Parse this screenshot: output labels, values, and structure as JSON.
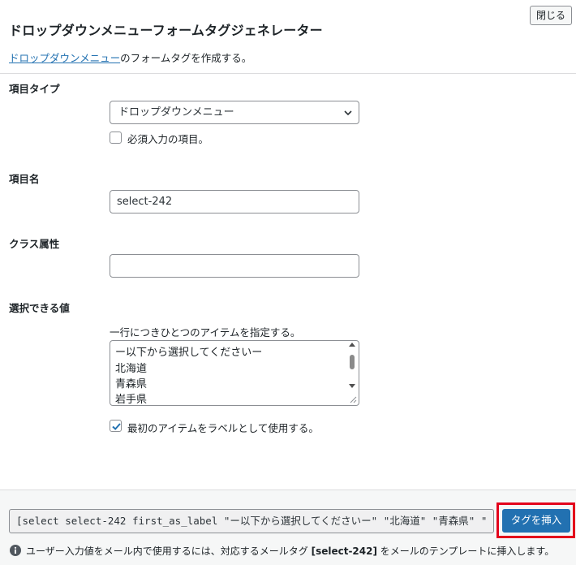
{
  "dialog": {
    "close_label": "閉じる",
    "title": "ドロップダウンメニューフォームタグジェネレーター",
    "description_link": "ドロップダウンメニュー",
    "description_suffix": "のフォームタグを作成する。"
  },
  "fields": {
    "type": {
      "label": "項目タイプ",
      "selected": "ドロップダウンメニュー",
      "required_label": "必須入力の項目。",
      "required_checked": false
    },
    "name": {
      "label": "項目名",
      "value": "select-242"
    },
    "class": {
      "label": "クラス属性",
      "value": ""
    },
    "options": {
      "label": "選択できる値",
      "hint": "一行につきひとつのアイテムを指定する。",
      "lines": [
        "ー以下から選択してくださいー",
        "北海道",
        "青森県",
        "岩手県"
      ],
      "first_as_label": "最初のアイテムをラベルとして使用する。",
      "first_as_label_checked": true
    }
  },
  "footer": {
    "tag_code": "[select select-242 first_as_label \"ー以下から選択してくださいー\" \"北海道\" \"青森県\" \"",
    "insert_label": "タグを挿入",
    "note_prefix": "ユーザー入力値をメール内で使用するには、対応するメールタグ ",
    "note_tag": "[select-242]",
    "note_suffix": " をメールのテンプレートに挿入します。"
  },
  "colors": {
    "accent": "#2271b1",
    "highlight": "#e3001b"
  }
}
